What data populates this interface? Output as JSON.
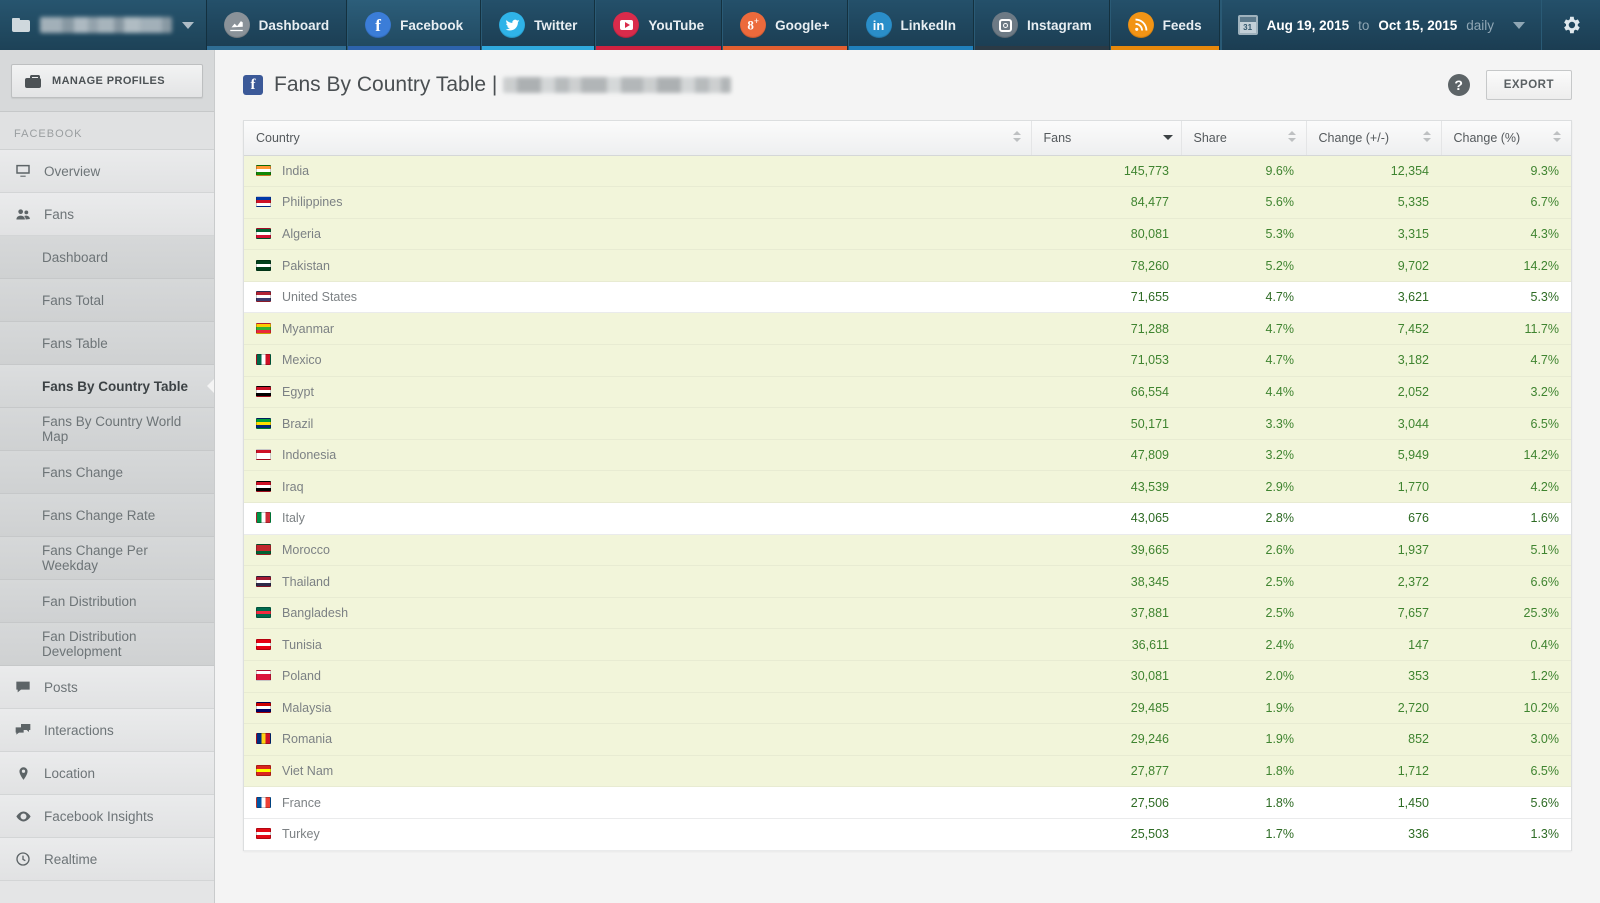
{
  "topnav": {
    "profile_picker": {
      "name_redacted": true,
      "icon": "folder-icon",
      "caret": "chevron-down-icon"
    },
    "tabs": [
      {
        "label": "Dashboard",
        "icon": "chart-icon",
        "color": "#8a9299",
        "accent": "#2f6d93",
        "active": false
      },
      {
        "label": "Facebook",
        "icon": "facebook-icon",
        "color": "#3b7dd8",
        "accent": "#2d63ad",
        "active": true
      },
      {
        "label": "Twitter",
        "icon": "twitter-icon",
        "color": "#2fb3e8",
        "accent": "#2fa9dd",
        "active": false
      },
      {
        "label": "YouTube",
        "icon": "youtube-icon",
        "color": "#d92b4b",
        "accent": "#cf2240",
        "active": false
      },
      {
        "label": "Google+",
        "icon": "googleplus-icon",
        "color": "#ec6a3c",
        "accent": "#e25f30",
        "active": false
      },
      {
        "label": "LinkedIn",
        "icon": "linkedin-icon",
        "color": "#2a8ec9",
        "accent": "#2080bb",
        "active": false
      },
      {
        "label": "Instagram",
        "icon": "instagram-icon",
        "color": "#6d7a85",
        "accent": "#2b3a45",
        "active": false
      },
      {
        "label": "Feeds",
        "icon": "rss-icon",
        "color": "#f29415",
        "accent": "#e6880b",
        "active": false
      }
    ],
    "daterange": {
      "calendar_day": "31",
      "start": "Aug 19, 2015",
      "to": "to",
      "end": "Oct 15, 2015",
      "granularity": "daily",
      "caret": "chevron-down-icon"
    },
    "settings_icon": "gear-icon"
  },
  "sidebar": {
    "manage_profiles": "MANAGE PROFILES",
    "section_label": "FACEBOOK",
    "items": [
      {
        "label": "Overview",
        "icon": "monitor-icon",
        "type": "top",
        "active": false
      },
      {
        "label": "Fans",
        "icon": "people-icon",
        "type": "top",
        "active": false
      },
      {
        "label": "Dashboard",
        "icon": "",
        "type": "sub",
        "active": false
      },
      {
        "label": "Fans Total",
        "icon": "",
        "type": "sub",
        "active": false
      },
      {
        "label": "Fans Table",
        "icon": "",
        "type": "sub",
        "active": false
      },
      {
        "label": "Fans By Country Table",
        "icon": "",
        "type": "sub",
        "active": true
      },
      {
        "label": "Fans By Country World Map",
        "icon": "",
        "type": "sub",
        "active": false
      },
      {
        "label": "Fans Change",
        "icon": "",
        "type": "sub",
        "active": false
      },
      {
        "label": "Fans Change Rate",
        "icon": "",
        "type": "sub",
        "active": false
      },
      {
        "label": "Fans Change Per Weekday",
        "icon": "",
        "type": "sub",
        "active": false
      },
      {
        "label": "Fan Distribution",
        "icon": "",
        "type": "sub",
        "active": false
      },
      {
        "label": "Fan Distribution Development",
        "icon": "",
        "type": "sub",
        "active": false
      },
      {
        "label": "Posts",
        "icon": "speech-icon",
        "type": "top",
        "active": false
      },
      {
        "label": "Interactions",
        "icon": "speech2-icon",
        "type": "top",
        "active": false
      },
      {
        "label": "Location",
        "icon": "pin-icon",
        "type": "top",
        "active": false
      },
      {
        "label": "Facebook Insights",
        "icon": "eye-icon",
        "type": "top",
        "active": false
      },
      {
        "label": "Realtime",
        "icon": "clock-icon",
        "type": "top",
        "active": false
      }
    ]
  },
  "page": {
    "badge_icon": "facebook-icon",
    "title": "Fans By Country Table |",
    "profile_redacted": true,
    "help_label": "?",
    "export_label": "EXPORT"
  },
  "table": {
    "columns": [
      {
        "label": "Country",
        "align": "left",
        "sorted": false
      },
      {
        "label": "Fans",
        "align": "right",
        "sorted": true,
        "direction": "desc"
      },
      {
        "label": "Share",
        "align": "right",
        "sorted": false
      },
      {
        "label": "Change (+/-)",
        "align": "right",
        "sorted": false
      },
      {
        "label": "Change (%)",
        "align": "right",
        "sorted": false
      }
    ],
    "rows": [
      {
        "country": "India",
        "flag": [
          "#ff9933",
          "#ffffff",
          "#138808"
        ],
        "fans": "145,773",
        "share": "9.6%",
        "change": "12,354",
        "change_pct": "9.3%",
        "highlight": true
      },
      {
        "country": "Philippines",
        "flag": [
          "#0038a8",
          "#ce1126",
          "#ffffff"
        ],
        "fans": "84,477",
        "share": "5.6%",
        "change": "5,335",
        "change_pct": "6.7%",
        "highlight": true
      },
      {
        "country": "Algeria",
        "flag": [
          "#006233",
          "#ffffff",
          "#d21034"
        ],
        "fans": "80,081",
        "share": "5.3%",
        "change": "3,315",
        "change_pct": "4.3%",
        "highlight": true
      },
      {
        "country": "Pakistan",
        "flag": [
          "#01411c",
          "#ffffff",
          "#01411c"
        ],
        "fans": "78,260",
        "share": "5.2%",
        "change": "9,702",
        "change_pct": "14.2%",
        "highlight": true
      },
      {
        "country": "United States",
        "flag": [
          "#b22234",
          "#ffffff",
          "#3c3b6e"
        ],
        "fans": "71,655",
        "share": "4.7%",
        "change": "3,621",
        "change_pct": "5.3%",
        "highlight": false
      },
      {
        "country": "Myanmar",
        "flag": [
          "#fecb00",
          "#34b233",
          "#ea2839"
        ],
        "fans": "71,288",
        "share": "4.7%",
        "change": "7,452",
        "change_pct": "11.7%",
        "highlight": true
      },
      {
        "country": "Mexico",
        "flag": [
          "#006847",
          "#ffffff",
          "#ce1126"
        ],
        "fans": "71,053",
        "share": "4.7%",
        "change": "3,182",
        "change_pct": "4.7%",
        "highlight": true
      },
      {
        "country": "Egypt",
        "flag": [
          "#ce1126",
          "#ffffff",
          "#000000"
        ],
        "fans": "66,554",
        "share": "4.4%",
        "change": "2,052",
        "change_pct": "3.2%",
        "highlight": true
      },
      {
        "country": "Brazil",
        "flag": [
          "#009c3b",
          "#ffdf00",
          "#002776"
        ],
        "fans": "50,171",
        "share": "3.3%",
        "change": "3,044",
        "change_pct": "6.5%",
        "highlight": true
      },
      {
        "country": "Indonesia",
        "flag": [
          "#ce1126",
          "#ffffff",
          "#ffffff"
        ],
        "fans": "47,809",
        "share": "3.2%",
        "change": "5,949",
        "change_pct": "14.2%",
        "highlight": true
      },
      {
        "country": "Iraq",
        "flag": [
          "#ce1126",
          "#ffffff",
          "#000000"
        ],
        "fans": "43,539",
        "share": "2.9%",
        "change": "1,770",
        "change_pct": "4.2%",
        "highlight": true
      },
      {
        "country": "Italy",
        "flag": [
          "#009246",
          "#ffffff",
          "#ce2b37"
        ],
        "fans": "43,065",
        "share": "2.8%",
        "change": "676",
        "change_pct": "1.6%",
        "highlight": false
      },
      {
        "country": "Morocco",
        "flag": [
          "#c1272d",
          "#c1272d",
          "#006233"
        ],
        "fans": "39,665",
        "share": "2.6%",
        "change": "1,937",
        "change_pct": "5.1%",
        "highlight": true
      },
      {
        "country": "Thailand",
        "flag": [
          "#a51931",
          "#ffffff",
          "#2d2a4a"
        ],
        "fans": "38,345",
        "share": "2.5%",
        "change": "2,372",
        "change_pct": "6.6%",
        "highlight": true
      },
      {
        "country": "Bangladesh",
        "flag": [
          "#006a4e",
          "#f42a41",
          "#006a4e"
        ],
        "fans": "37,881",
        "share": "2.5%",
        "change": "7,657",
        "change_pct": "25.3%",
        "highlight": true
      },
      {
        "country": "Tunisia",
        "flag": [
          "#e70013",
          "#ffffff",
          "#e70013"
        ],
        "fans": "36,611",
        "share": "2.4%",
        "change": "147",
        "change_pct": "0.4%",
        "highlight": true
      },
      {
        "country": "Poland",
        "flag": [
          "#ffffff",
          "#dc143c",
          "#dc143c"
        ],
        "fans": "30,081",
        "share": "2.0%",
        "change": "353",
        "change_pct": "1.2%",
        "highlight": true
      },
      {
        "country": "Malaysia",
        "flag": [
          "#cc0001",
          "#ffffff",
          "#010066"
        ],
        "fans": "29,485",
        "share": "1.9%",
        "change": "2,720",
        "change_pct": "10.2%",
        "highlight": true
      },
      {
        "country": "Romania",
        "flag": [
          "#002b7f",
          "#fcd116",
          "#ce1126"
        ],
        "fans": "29,246",
        "share": "1.9%",
        "change": "852",
        "change_pct": "3.0%",
        "highlight": true
      },
      {
        "country": "Viet Nam",
        "flag": [
          "#da251d",
          "#ffff00",
          "#da251d"
        ],
        "fans": "27,877",
        "share": "1.8%",
        "change": "1,712",
        "change_pct": "6.5%",
        "highlight": true
      },
      {
        "country": "France",
        "flag": [
          "#0055a4",
          "#ffffff",
          "#ef4135"
        ],
        "fans": "27,506",
        "share": "1.8%",
        "change": "1,450",
        "change_pct": "5.6%",
        "highlight": false
      },
      {
        "country": "Turkey",
        "flag": [
          "#e30a17",
          "#ffffff",
          "#e30a17"
        ],
        "fans": "25,503",
        "share": "1.7%",
        "change": "336",
        "change_pct": "1.3%",
        "highlight": false
      }
    ]
  }
}
